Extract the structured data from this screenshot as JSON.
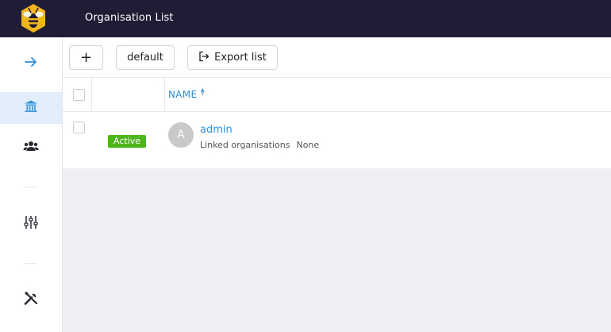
{
  "header": {
    "title": "Organisation List",
    "logo": "bee-logo"
  },
  "sidebar": {
    "items": [
      {
        "icon": "arrow-right-icon"
      },
      {
        "icon": "bank-icon",
        "active": true
      },
      {
        "icon": "users-icon"
      },
      {
        "icon": "sliders-icon"
      },
      {
        "icon": "tools-icon"
      }
    ]
  },
  "toolbar": {
    "add_label": "+",
    "default_label": "default",
    "export_label": "Export list"
  },
  "table": {
    "columns": {
      "name": "NAME"
    },
    "rows": [
      {
        "status": "Active",
        "avatar_initial": "A",
        "name": "admin",
        "linked_label": "Linked organisations",
        "linked_value": "None"
      }
    ]
  },
  "colors": {
    "topbar": "#1f1c36",
    "accent": "#2f8fd6",
    "active_badge": "#4cb71a",
    "active_nav_bg": "#e1eef9"
  }
}
